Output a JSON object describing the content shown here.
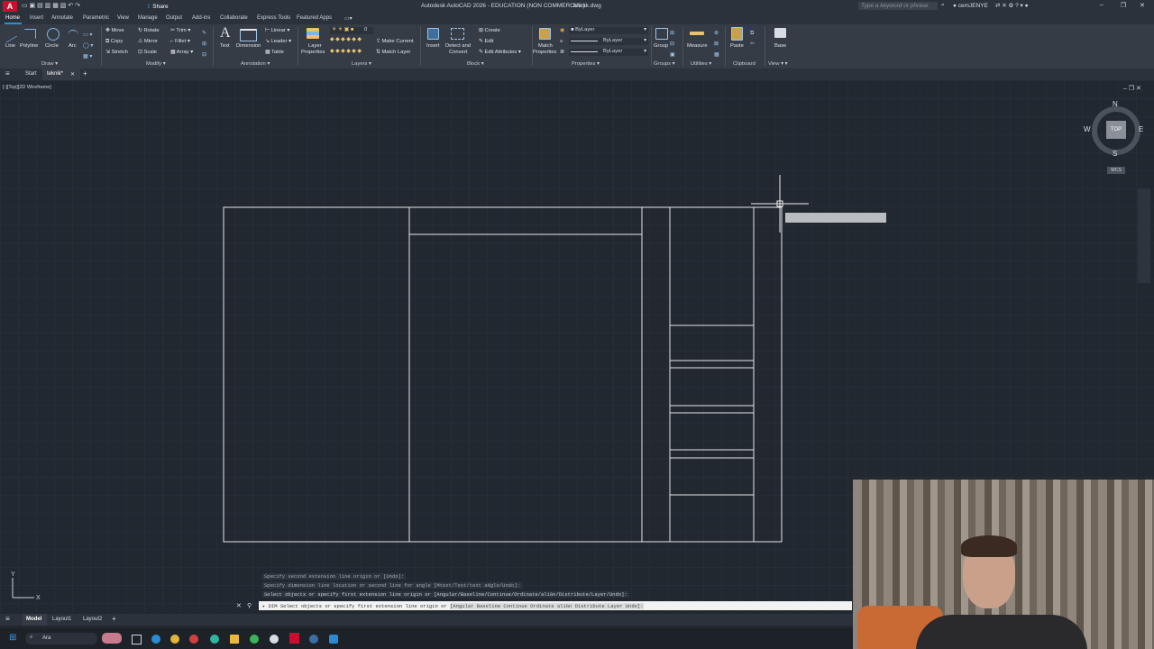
{
  "app": {
    "logo_letter": "A",
    "title": "Autodesk AutoCAD 2026 - EDUCATION (NON COMMERCIAL)",
    "filename": "teknik.dwg",
    "share_label": "Share",
    "search_placeholder": "Type a keyword or phrase",
    "user": "cemJENYE"
  },
  "ribbon_tabs": [
    "Home",
    "Insert",
    "Annotate",
    "Parametric",
    "View",
    "Manage",
    "Output",
    "Add-ins",
    "Collaborate",
    "Express Tools",
    "Featured Apps"
  ],
  "ribbon": {
    "draw": {
      "line": "Line",
      "polyline": "Polyline",
      "circle": "Circle",
      "arc": "Arc",
      "panel": "Draw"
    },
    "modify": {
      "move": "Move",
      "rotate": "Rotate",
      "trim": "Trim",
      "copy": "Copy",
      "mirror": "Mirror",
      "fillet": "Fillet",
      "stretch": "Stretch",
      "scale": "Scale",
      "array": "Array",
      "panel": "Modify"
    },
    "annotation": {
      "text": "Text",
      "dimension": "Dimension",
      "linear": "Linear",
      "leader": "Leader",
      "table": "Table",
      "panel": "Annotation"
    },
    "layers": {
      "layer_properties_1": "Layer",
      "layer_properties_2": "Properties",
      "current": "0",
      "make_current": "Make Current",
      "match_layer": "Match Layer",
      "panel": "Layers"
    },
    "block": {
      "insert": "Insert",
      "detect_1": "Detect and",
      "detect_2": "Convert",
      "create": "Create",
      "edit": "Edit",
      "edit_attributes": "Edit Attributes",
      "panel": "Block"
    },
    "properties": {
      "match_1": "Match",
      "match_2": "Properties",
      "bylayer_1": "ByLayer",
      "bylayer_2": "ByLayer",
      "bylayer_3": "ByLayer",
      "panel": "Properties"
    },
    "groups": {
      "group": "Group",
      "panel": "Groups"
    },
    "utilities": {
      "measure": "Measure",
      "panel": "Utilities"
    },
    "clipboard": {
      "paste": "Paste",
      "panel": "Clipboard"
    },
    "view": {
      "base": "Base",
      "panel": "View"
    }
  },
  "file_tabs": {
    "start": "Start",
    "active": "teknik*"
  },
  "viewport": {
    "label": "[-][Top][2D Wireframe]",
    "compass": {
      "n": "N",
      "s": "S",
      "e": "E",
      "w": "W",
      "face": "TOP",
      "wcs": "WCS"
    }
  },
  "command_history": [
    "Specify second extension line origin or [Undo]:",
    "Specify dimension line location or second line for angle [Mtext/Text/text aNgle/Undo]:",
    "Select objects or specify first extension line origin or [Angular/Baseline/Continue/Ordinate/aliGn/Distribute/Layer/Undo]:"
  ],
  "command_input": {
    "prefix": "DIM",
    "text": "Select objects or specify first extension line origin or",
    "options": "[Angular Baseline Continue Ordinate aliGn Distribute Layer Undo]:"
  },
  "layout_tabs": [
    "Model",
    "Layout1",
    "Layout2"
  ],
  "taskbar": {
    "search_label": "Ara"
  },
  "colors": {
    "accent": "#2f8fd6",
    "viewport_bg": "#212830",
    "ribbon_bg": "#353c46"
  }
}
